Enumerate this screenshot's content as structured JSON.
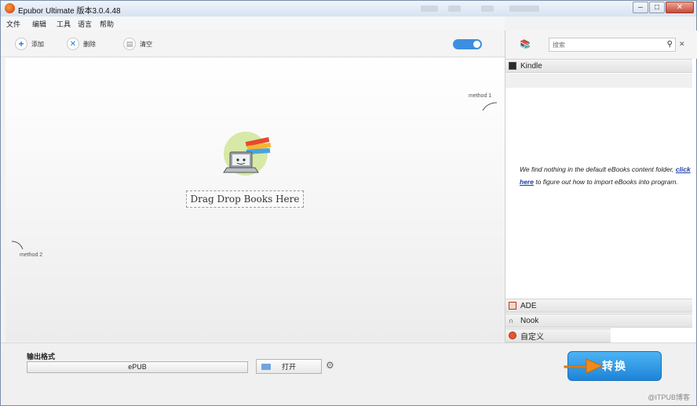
{
  "window": {
    "title": "Epubor Ultimate 版本3.0.4.48"
  },
  "menu": [
    "文件",
    "编辑",
    "工具",
    "语言",
    "帮助"
  ],
  "toolbar": {
    "add_label": "添加",
    "remove_label": "删除",
    "clear_label": "清空"
  },
  "main": {
    "method1": "method 1",
    "method2": "method 2",
    "drop_label": "Drag Drop Books Here"
  },
  "panel": {
    "search_placeholder": "搜索",
    "kindle": "Kindle",
    "empty_msg_1": "We find nothing in the default eBooks content folder,",
    "click_here": "click here",
    "empty_msg_2": "to figure out how to import eBooks into program.",
    "ade": "ADE",
    "nook": "Nook",
    "custom": "自定义"
  },
  "bottom": {
    "output_label": "输出格式",
    "format_value": "ePUB",
    "open_label": "打开",
    "convert_label": "转换"
  },
  "watermark": "@ITPUB博客"
}
